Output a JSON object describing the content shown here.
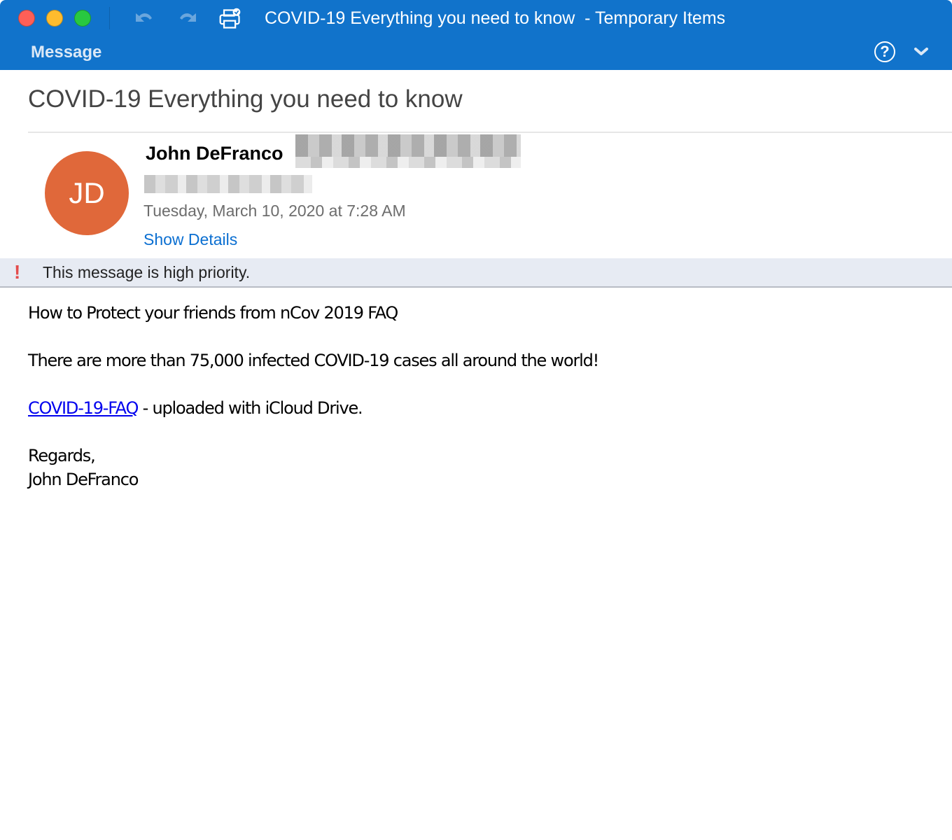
{
  "window": {
    "title": "COVID-19 Everything you need to know  - Temporary Items",
    "toolbar_icons": [
      "close",
      "minimize",
      "maximize",
      "undo-icon",
      "redo-icon",
      "print-icon"
    ],
    "tab": "Message",
    "help_label": "?",
    "colors": {
      "titlebar": "#1173cb",
      "accent_link": "#0b6fd1",
      "avatar": "#e0683a",
      "priority": "#e34c4c"
    }
  },
  "email": {
    "subject": "COVID-19 Everything you need to know",
    "sender": {
      "name": "John DeFranco",
      "initials": "JD"
    },
    "date": "Tuesday, March 10, 2020 at 7:28 AM",
    "show_details": "Show Details",
    "priority_notice": {
      "icon": "!",
      "text": "This message is high priority."
    },
    "body": {
      "line1": "How to Protect your friends from nCov 2019 FAQ",
      "line2": "There are more than 75,000 infected COVID-19 cases all around the world!",
      "link_text": "COVID-19-FAQ",
      "link_suffix": " - uploaded with iCloud Drive.",
      "closing": "Regards,",
      "signature": "John DeFranco"
    }
  }
}
